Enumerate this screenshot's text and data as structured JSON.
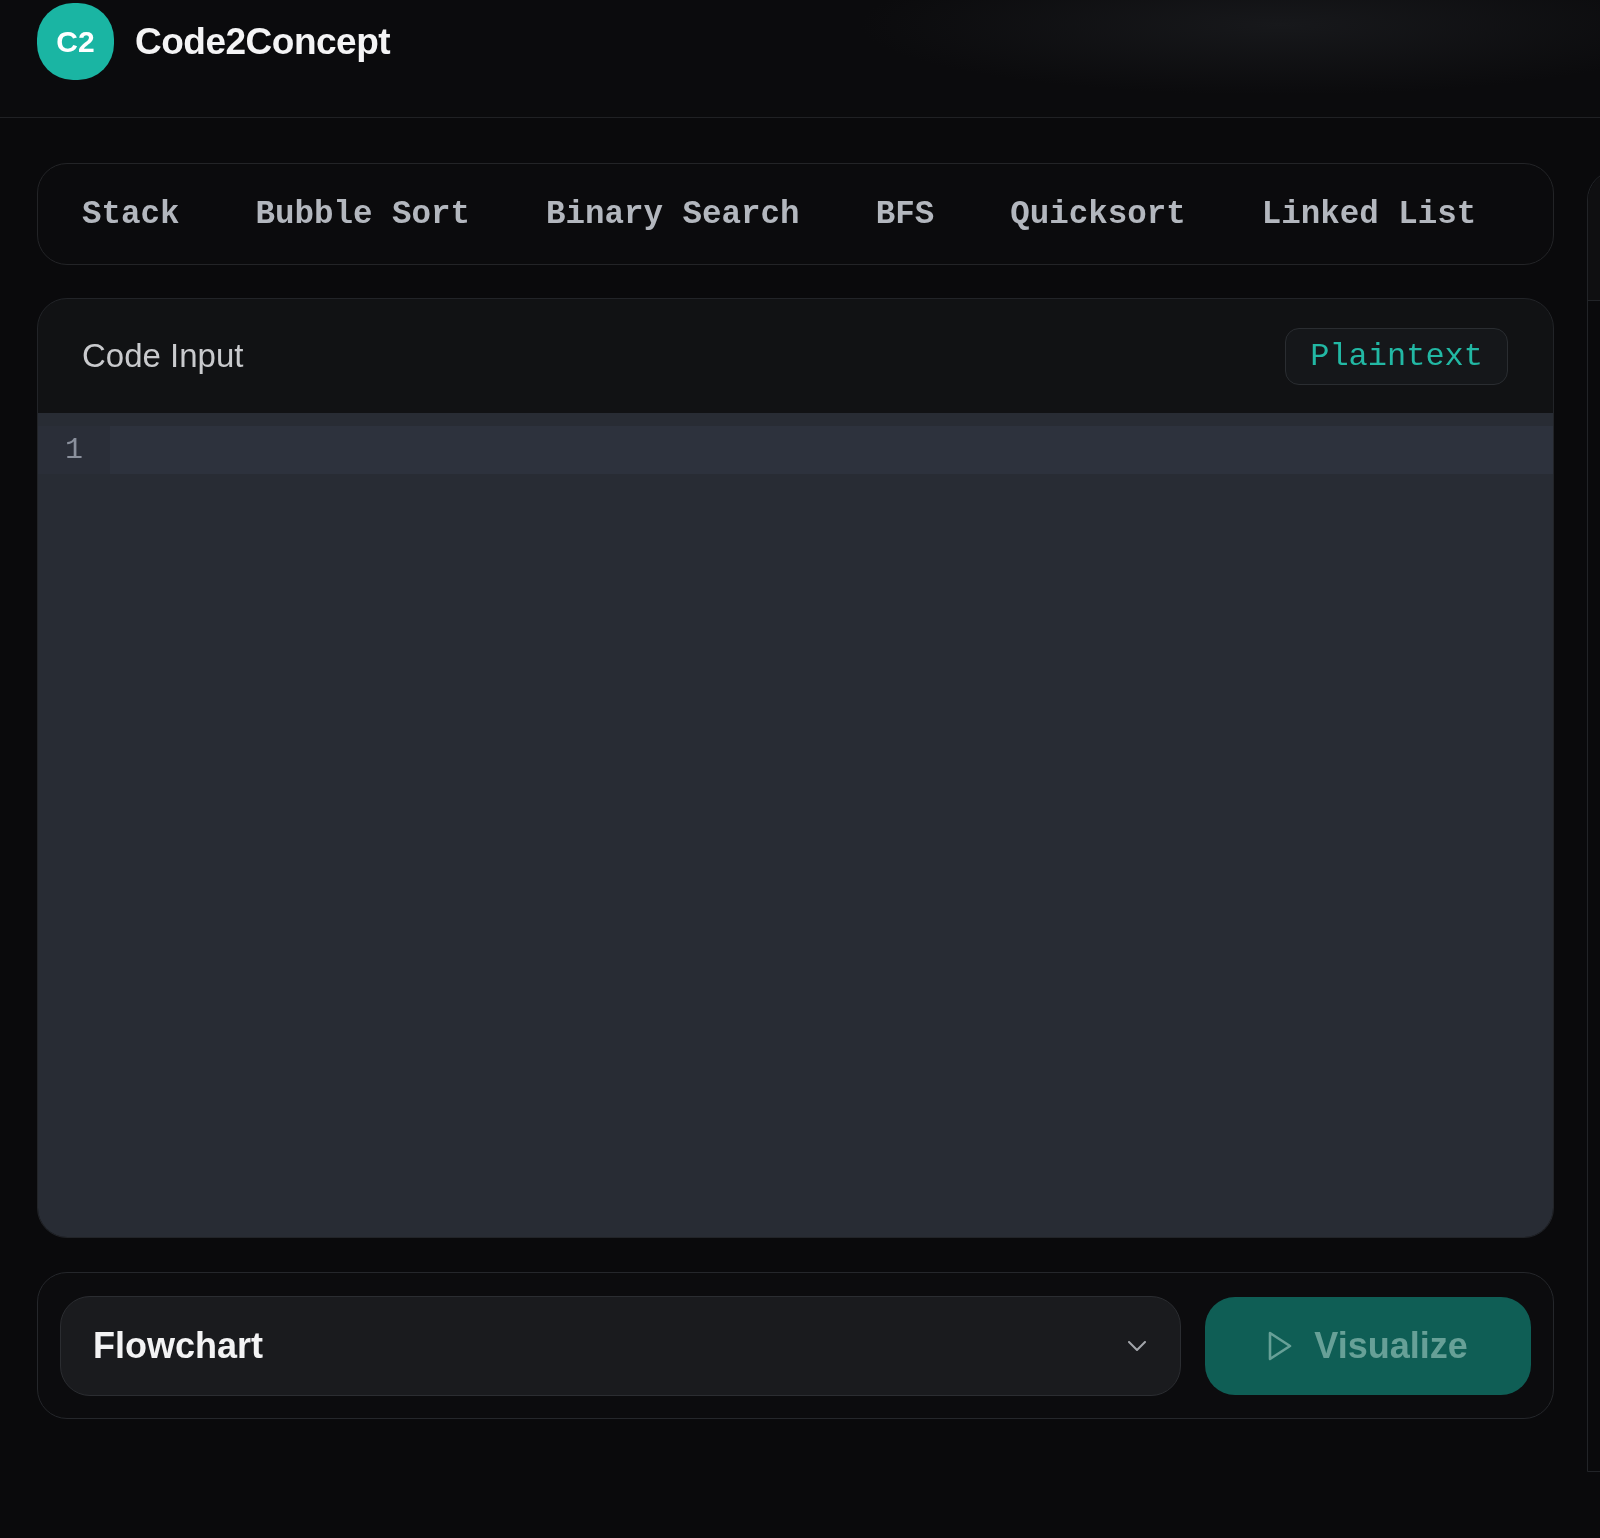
{
  "header": {
    "logo": "C2",
    "title": "Code2Concept"
  },
  "examples": [
    "Stack",
    "Bubble Sort",
    "Binary Search",
    "BFS",
    "Quicksort",
    "Linked List"
  ],
  "code_input": {
    "title": "Code Input",
    "language": "Plaintext",
    "line_numbers": [
      "1"
    ]
  },
  "controls": {
    "diagram_type": "Flowchart",
    "visualize_button": {
      "label": "Visualize",
      "disabled": true
    }
  }
}
